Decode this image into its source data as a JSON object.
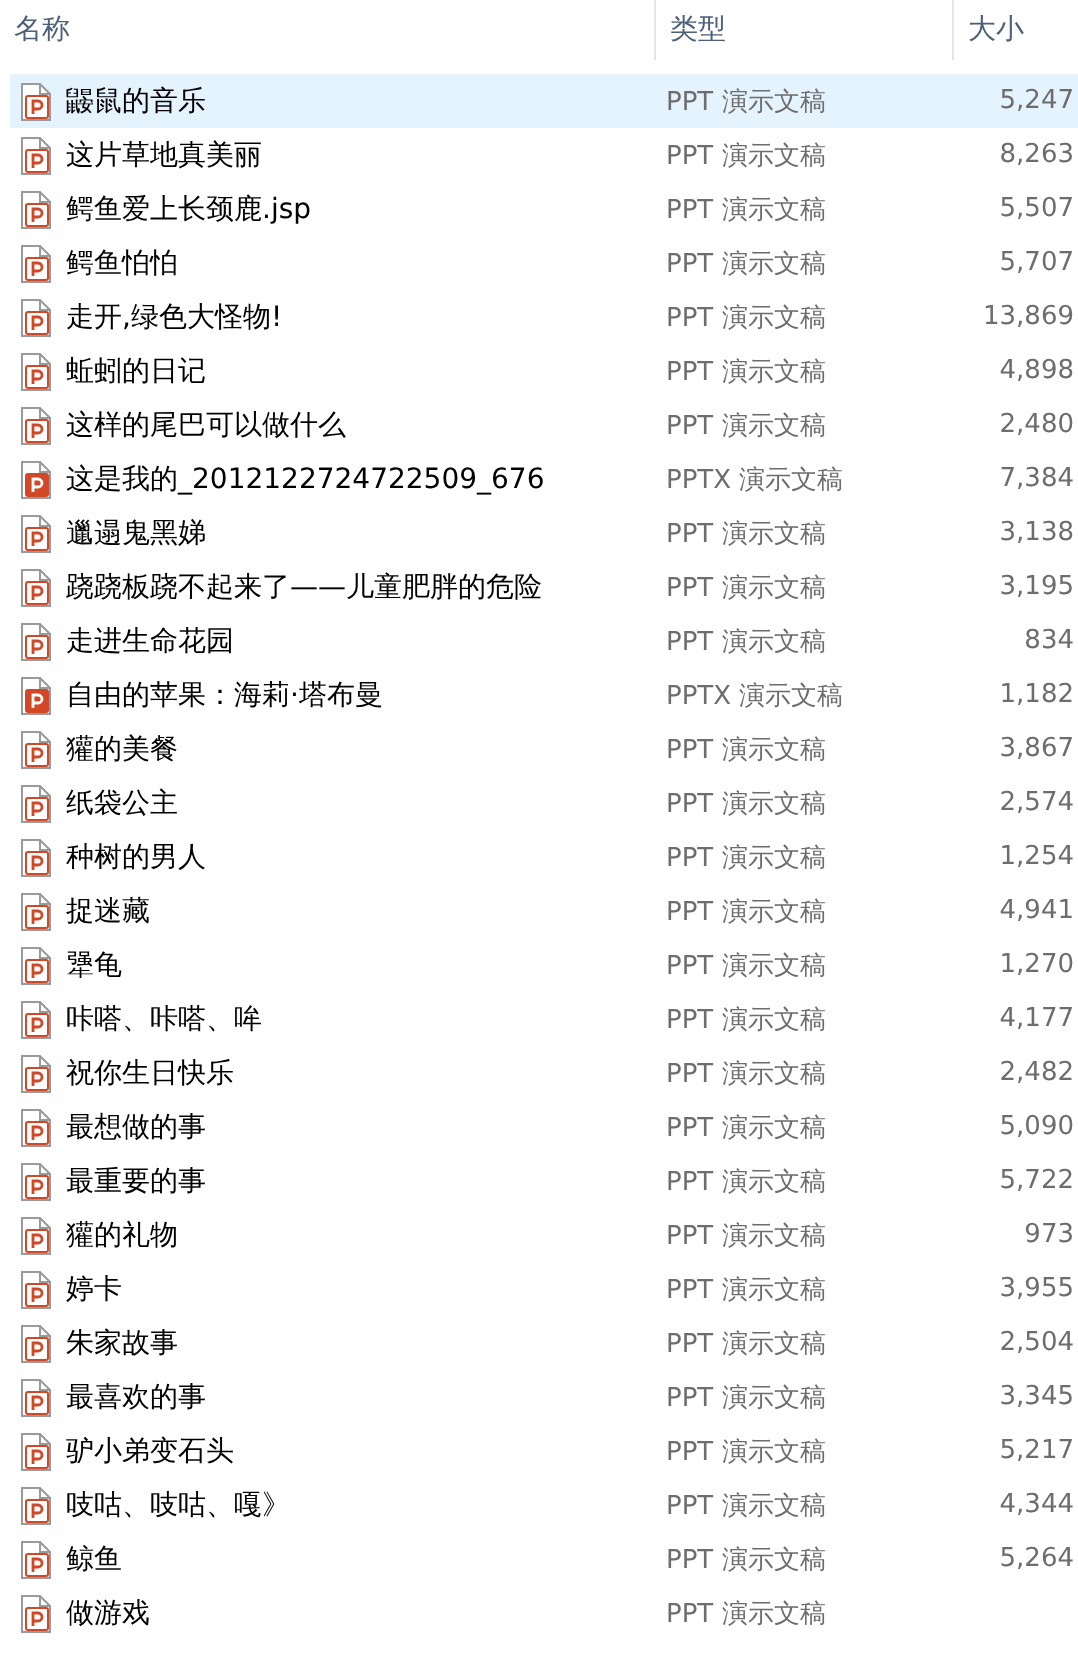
{
  "columns": [
    {
      "label": "名称"
    },
    {
      "label": "类型"
    },
    {
      "label": "大小"
    }
  ],
  "rows": [
    {
      "name": "鼹鼠的音乐",
      "kind": "ppt",
      "type": "PPT 演示文稿",
      "size": "5,247",
      "selected": true
    },
    {
      "name": "这片草地真美丽",
      "kind": "ppt",
      "type": "PPT 演示文稿",
      "size": "8,263",
      "selected": false
    },
    {
      "name": "鳄鱼爱上长颈鹿.jsp",
      "kind": "ppt",
      "type": "PPT 演示文稿",
      "size": "5,507",
      "selected": false
    },
    {
      "name": "鳄鱼怕怕",
      "kind": "ppt",
      "type": "PPT 演示文稿",
      "size": "5,707",
      "selected": false
    },
    {
      "name": "走开,绿色大怪物!",
      "kind": "ppt",
      "type": "PPT 演示文稿",
      "size": "13,869",
      "selected": false
    },
    {
      "name": "蚯蚓的日记",
      "kind": "ppt",
      "type": "PPT 演示文稿",
      "size": "4,898",
      "selected": false
    },
    {
      "name": "这样的尾巴可以做什么",
      "kind": "ppt",
      "type": "PPT 演示文稿",
      "size": "2,480",
      "selected": false
    },
    {
      "name": "这是我的_2012122724722509_676",
      "kind": "pptx",
      "type": "PPTX 演示文稿",
      "size": "7,384",
      "selected": false
    },
    {
      "name": "邋遢鬼黑娣",
      "kind": "ppt",
      "type": "PPT 演示文稿",
      "size": "3,138",
      "selected": false
    },
    {
      "name": "跷跷板跷不起来了——儿童肥胖的危险",
      "kind": "ppt",
      "type": "PPT 演示文稿",
      "size": "3,195",
      "selected": false
    },
    {
      "name": "走进生命花园",
      "kind": "ppt",
      "type": "PPT 演示文稿",
      "size": "834",
      "selected": false
    },
    {
      "name": "自由的苹果：海莉·塔布曼",
      "kind": "pptx",
      "type": "PPTX 演示文稿",
      "size": "1,182",
      "selected": false
    },
    {
      "name": "獾的美餐",
      "kind": "ppt",
      "type": "PPT 演示文稿",
      "size": "3,867",
      "selected": false
    },
    {
      "name": "纸袋公主",
      "kind": "ppt",
      "type": "PPT 演示文稿",
      "size": "2,574",
      "selected": false
    },
    {
      "name": "种树的男人",
      "kind": "ppt",
      "type": "PPT 演示文稿",
      "size": "1,254",
      "selected": false
    },
    {
      "name": "捉迷藏",
      "kind": "ppt",
      "type": "PPT 演示文稿",
      "size": "4,941",
      "selected": false
    },
    {
      "name": "犟龟",
      "kind": "ppt",
      "type": "PPT 演示文稿",
      "size": "1,270",
      "selected": false
    },
    {
      "name": "咔嗒、咔嗒、哞",
      "kind": "ppt",
      "type": "PPT 演示文稿",
      "size": "4,177",
      "selected": false
    },
    {
      "name": "祝你生日快乐",
      "kind": "ppt",
      "type": "PPT 演示文稿",
      "size": "2,482",
      "selected": false
    },
    {
      "name": "最想做的事",
      "kind": "ppt",
      "type": "PPT 演示文稿",
      "size": "5,090",
      "selected": false
    },
    {
      "name": "最重要的事",
      "kind": "ppt",
      "type": "PPT 演示文稿",
      "size": "5,722",
      "selected": false
    },
    {
      "name": "獾的礼物",
      "kind": "ppt",
      "type": "PPT 演示文稿",
      "size": "973",
      "selected": false
    },
    {
      "name": "婷卡",
      "kind": "ppt",
      "type": "PPT 演示文稿",
      "size": "3,955",
      "selected": false
    },
    {
      "name": "朱家故事",
      "kind": "ppt",
      "type": "PPT 演示文稿",
      "size": "2,504",
      "selected": false
    },
    {
      "name": "最喜欢的事",
      "kind": "ppt",
      "type": "PPT 演示文稿",
      "size": "3,345",
      "selected": false
    },
    {
      "name": "驴小弟变石头",
      "kind": "ppt",
      "type": "PPT 演示文稿",
      "size": "5,217",
      "selected": false
    },
    {
      "name": "吱咕、吱咕、嘎》",
      "kind": "ppt",
      "type": "PPT 演示文稿",
      "size": "4,344",
      "selected": false
    },
    {
      "name": "鲸鱼",
      "kind": "ppt",
      "type": "PPT 演示文稿",
      "size": "5,264",
      "selected": false
    },
    {
      "name": "做游戏",
      "kind": "ppt",
      "type": "PPT 演示文稿",
      "selected": false
    }
  ]
}
